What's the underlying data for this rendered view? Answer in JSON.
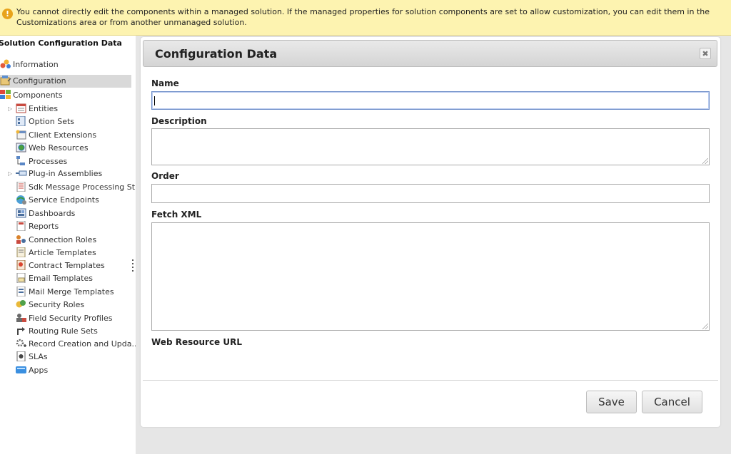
{
  "banner": {
    "text": "You cannot directly edit the components within a managed solution. If the managed properties for solution components are set to allow customization, you can edit them in the Customizations area or from another unmanaged solution."
  },
  "sidebar": {
    "title": "Solution Configuration Data",
    "items": [
      {
        "label": "Information",
        "icon": "information-icon"
      },
      {
        "label": "Configuration",
        "icon": "configuration-icon",
        "selected": true
      },
      {
        "label": "Components",
        "icon": "components-icon"
      },
      {
        "label": "Entities",
        "icon": "entities-icon"
      },
      {
        "label": "Option Sets",
        "icon": "option-sets-icon"
      },
      {
        "label": "Client Extensions",
        "icon": "client-extensions-icon"
      },
      {
        "label": "Web Resources",
        "icon": "web-resources-icon"
      },
      {
        "label": "Processes",
        "icon": "processes-icon"
      },
      {
        "label": "Plug-in Assemblies",
        "icon": "plugin-assemblies-icon"
      },
      {
        "label": "Sdk Message Processing St...",
        "icon": "sdk-message-icon"
      },
      {
        "label": "Service Endpoints",
        "icon": "service-endpoints-icon"
      },
      {
        "label": "Dashboards",
        "icon": "dashboards-icon"
      },
      {
        "label": "Reports",
        "icon": "reports-icon"
      },
      {
        "label": "Connection Roles",
        "icon": "connection-roles-icon"
      },
      {
        "label": "Article Templates",
        "icon": "article-templates-icon"
      },
      {
        "label": "Contract Templates",
        "icon": "contract-templates-icon"
      },
      {
        "label": "Email Templates",
        "icon": "email-templates-icon"
      },
      {
        "label": "Mail Merge Templates",
        "icon": "mail-merge-templates-icon"
      },
      {
        "label": "Security Roles",
        "icon": "security-roles-icon"
      },
      {
        "label": "Field Security Profiles",
        "icon": "field-security-profiles-icon"
      },
      {
        "label": "Routing Rule Sets",
        "icon": "routing-rule-sets-icon"
      },
      {
        "label": "Record Creation and Upda...",
        "icon": "record-creation-icon"
      },
      {
        "label": "SLAs",
        "icon": "slas-icon"
      },
      {
        "label": "Apps",
        "icon": "apps-icon"
      }
    ]
  },
  "panel": {
    "title": "Configuration Data",
    "fields": {
      "name_label": "Name",
      "name_value": "",
      "description_label": "Description",
      "description_value": "",
      "order_label": "Order",
      "order_value": "",
      "fetch_xml_label": "Fetch XML",
      "fetch_xml_value": "",
      "web_resource_url_label": "Web Resource URL"
    },
    "save_label": "Save",
    "cancel_label": "Cancel"
  },
  "colors": {
    "banner_bg": "#fdf3b0",
    "selected_bg": "#d9d9d9",
    "focus_border": "#6f8fc9"
  }
}
